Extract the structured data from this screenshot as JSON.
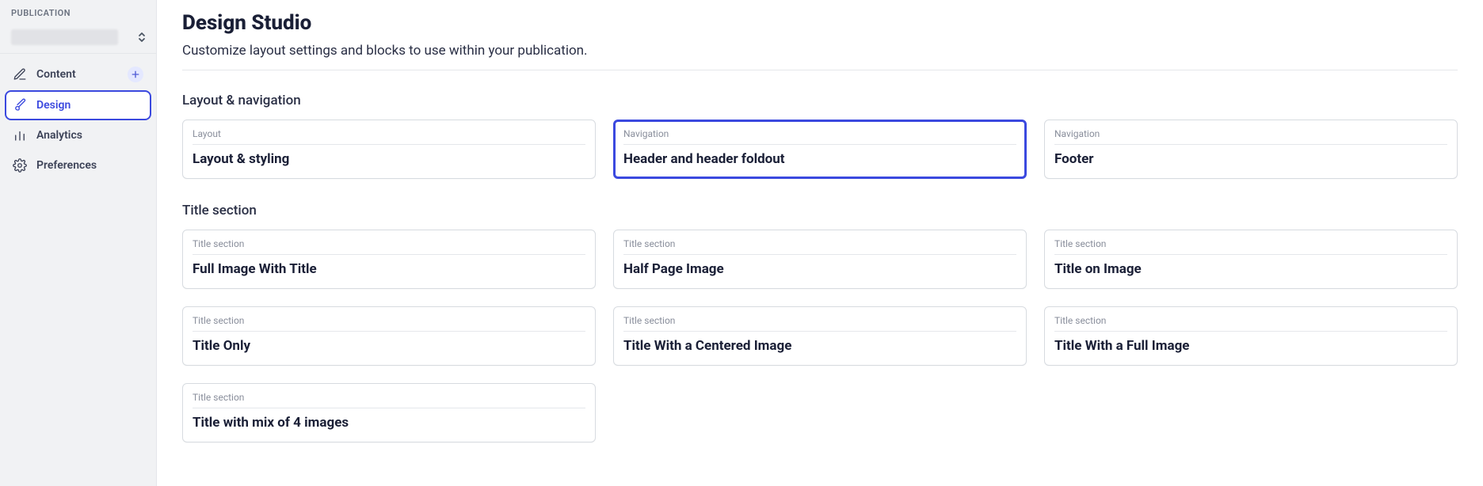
{
  "sidebar": {
    "section_label": "PUBLICATION",
    "items": [
      {
        "label": "Content",
        "has_add": true
      },
      {
        "label": "Design",
        "active": true
      },
      {
        "label": "Analytics"
      },
      {
        "label": "Preferences"
      }
    ]
  },
  "page": {
    "title": "Design Studio",
    "subtitle": "Customize layout settings and blocks to use within your publication."
  },
  "sections": [
    {
      "heading": "Layout & navigation",
      "cards": [
        {
          "eyebrow": "Layout",
          "title": "Layout & styling"
        },
        {
          "eyebrow": "Navigation",
          "title": "Header and header foldout",
          "selected": true
        },
        {
          "eyebrow": "Navigation",
          "title": "Footer"
        }
      ]
    },
    {
      "heading": "Title section",
      "cards": [
        {
          "eyebrow": "Title section",
          "title": "Full Image With Title"
        },
        {
          "eyebrow": "Title section",
          "title": "Half Page Image"
        },
        {
          "eyebrow": "Title section",
          "title": "Title on Image"
        },
        {
          "eyebrow": "Title section",
          "title": "Title Only"
        },
        {
          "eyebrow": "Title section",
          "title": "Title With a Centered Image"
        },
        {
          "eyebrow": "Title section",
          "title": "Title With a Full Image"
        },
        {
          "eyebrow": "Title section",
          "title": "Title with mix of 4 images"
        }
      ]
    }
  ]
}
